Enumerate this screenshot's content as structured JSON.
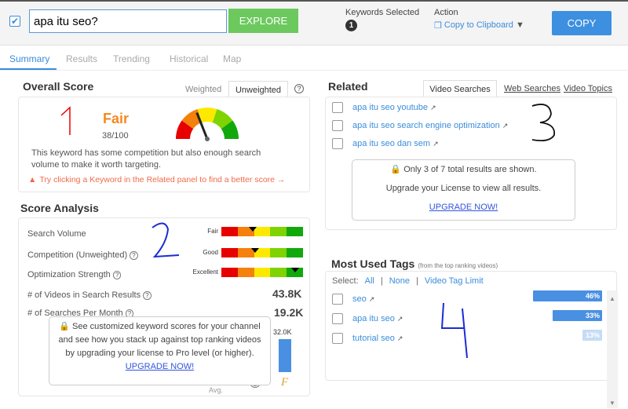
{
  "header": {
    "search_value": "apa itu seo?",
    "explore": "EXPLORE",
    "keywords_selected_label": "Keywords Selected",
    "keywords_selected_count": "1",
    "action_label": "Action",
    "action_value": "Copy to Clipboard",
    "copy": "COPY"
  },
  "tabs": [
    {
      "label": "Summary",
      "active": true
    },
    {
      "label": "Results"
    },
    {
      "label": "Trending"
    },
    {
      "label": "Historical"
    },
    {
      "label": "Map"
    }
  ],
  "overall": {
    "title": "Overall Score",
    "weighted": "Weighted",
    "unweighted": "Unweighted",
    "help": "?",
    "rating": "Fair",
    "score": "38/100",
    "score_value": 38,
    "description": "This keyword has some competition but also enough search volume to make it worth targeting.",
    "tip": "Try clicking a Keyword in the Related panel to find a better score →",
    "rating_color": "#f5891f"
  },
  "analysis": {
    "title": "Score Analysis",
    "rows": [
      {
        "label": "Search Volume",
        "rating": "Fair",
        "level": 0.38
      },
      {
        "label": "Competition (Unweighted)",
        "rating": "Good",
        "level": 0.41
      },
      {
        "label": "Optimization Strength",
        "rating": "Excellent",
        "level": 0.9
      }
    ],
    "videos_label": "# of Videos in Search Results",
    "videos_value": "43.8K",
    "searches_label": "# of Searches Per Month",
    "searches_value": "19.2K",
    "chart_label": "32.0K",
    "chart_avg": "Avg.",
    "grade": "F",
    "overlay_text": "See customized keyword scores for your channel and see how you stack up against top ranking videos by upgrading your license to Pro level (or higher).",
    "overlay_link": "UPGRADE NOW!"
  },
  "related": {
    "title": "Related",
    "tabs": [
      "Video Searches",
      "Web Searches",
      "Video Topics"
    ],
    "items": [
      "apa itu seo youtube",
      "apa itu seo search engine optimization",
      "apa itu seo dan sem"
    ],
    "notice": "Only 3 of 7 total results are shown.",
    "notice2": "Upgrade your License to view all results.",
    "upgrade": "UPGRADE NOW!"
  },
  "tags": {
    "title": "Most Used Tags",
    "subtitle": "(from the top ranking videos)",
    "select_label": "Select:",
    "all": "All",
    "none": "None",
    "limit": "Video Tag Limit",
    "items": [
      {
        "tag": "seo",
        "pct": "46%",
        "value": 46
      },
      {
        "tag": "apa itu seo",
        "pct": "33%",
        "value": 33
      },
      {
        "tag": "tutorial seo",
        "pct": "13%",
        "value": 13
      }
    ]
  },
  "annotations": [
    "1",
    "2",
    "3",
    "4"
  ]
}
